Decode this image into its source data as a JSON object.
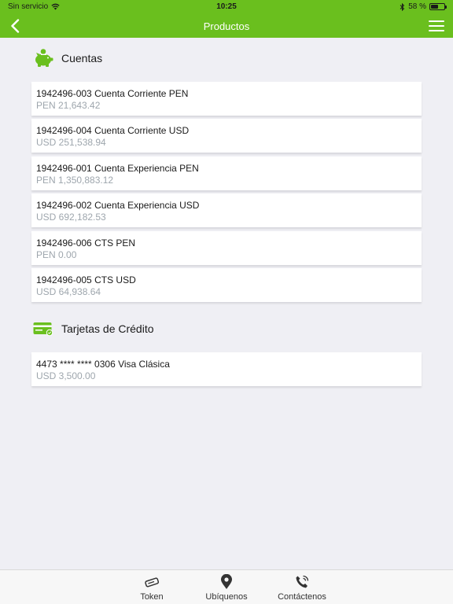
{
  "status": {
    "carrier": "Sin servicio",
    "time": "10:25",
    "battery": "58 %",
    "battery_level": 0.58
  },
  "header": {
    "title": "Productos"
  },
  "sections": {
    "accounts": {
      "title": "Cuentas",
      "items": [
        {
          "name": "1942496-003 Cuenta Corriente PEN",
          "balance": "PEN 21,643.42"
        },
        {
          "name": "1942496-004 Cuenta Corriente USD",
          "balance": "USD 251,538.94"
        },
        {
          "name": "1942496-001 Cuenta Experiencia PEN",
          "balance": "PEN 1,350,883.12"
        },
        {
          "name": "1942496-002 Cuenta Experiencia USD",
          "balance": "USD 692,182.53"
        },
        {
          "name": "1942496-006 CTS PEN",
          "balance": "PEN 0.00"
        },
        {
          "name": "1942496-005 CTS USD",
          "balance": "USD 64,938.64"
        }
      ]
    },
    "cards": {
      "title": "Tarjetas de Crédito",
      "items": [
        {
          "name": "4473 **** **** 0306 Visa Clásica",
          "balance": "USD 3,500.00"
        }
      ]
    }
  },
  "tabs": [
    {
      "label": "Token",
      "icon": "token-icon"
    },
    {
      "label": "Ubíquenos",
      "icon": "location-pin-icon"
    },
    {
      "label": "Contáctenos",
      "icon": "phone-icon"
    }
  ],
  "colors": {
    "brand": "#6abf1e",
    "secondary_text": "#9ea6ad",
    "background": "#efeff4"
  }
}
